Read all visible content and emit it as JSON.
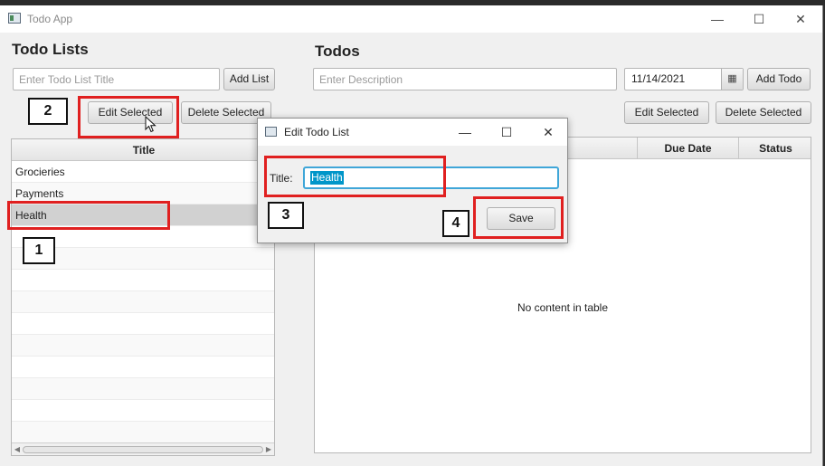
{
  "window": {
    "title": "Todo App"
  },
  "left": {
    "heading": "Todo Lists",
    "title_placeholder": "Enter Todo List Title",
    "add_list_label": "Add List",
    "edit_selected_label": "Edit Selected",
    "delete_selected_label": "Delete Selected",
    "table_header": "Title",
    "items": [
      "Grocieries",
      "Payments",
      "Health"
    ]
  },
  "right": {
    "heading": "Todos",
    "description_placeholder": "Enter Description",
    "date_value": "11/14/2021",
    "add_todo_label": "Add Todo",
    "edit_selected_label": "Edit Selected",
    "delete_selected_label": "Delete Selected",
    "columns": [
      "Due Date",
      "Status"
    ],
    "empty_message": "No content in table"
  },
  "dialog": {
    "title": "Edit Todo List",
    "field_label": "Title:",
    "field_value": "Health",
    "save_label": "Save"
  },
  "annotations": [
    "1",
    "2",
    "3",
    "4"
  ],
  "colors": {
    "highlight": "#e02020",
    "selection": "#0096c9"
  }
}
